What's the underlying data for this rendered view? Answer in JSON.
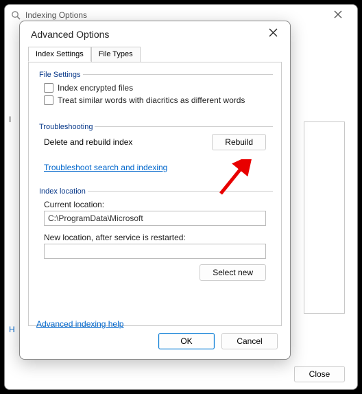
{
  "outer": {
    "title": "Indexing Options",
    "left_label_truncated": "I",
    "left_help_truncated": "H",
    "close_label": "Close"
  },
  "inner": {
    "title": "Advanced Options",
    "tabs": {
      "index_settings": "Index Settings",
      "file_types": "File Types"
    },
    "file_settings": {
      "heading": "File Settings",
      "index_encrypted": "Index encrypted files",
      "treat_diacritics": "Treat similar words with diacritics as different words"
    },
    "troubleshooting": {
      "heading": "Troubleshooting",
      "delete_rebuild_label": "Delete and rebuild index",
      "rebuild_button": "Rebuild",
      "troubleshoot_link": "Troubleshoot search and indexing"
    },
    "index_location": {
      "heading": "Index location",
      "current_label": "Current location:",
      "current_value": "C:\\ProgramData\\Microsoft",
      "new_label": "New location, after service is restarted:",
      "new_value": "",
      "select_new": "Select new"
    },
    "help_link": "Advanced indexing help",
    "ok": "OK",
    "cancel": "Cancel"
  }
}
